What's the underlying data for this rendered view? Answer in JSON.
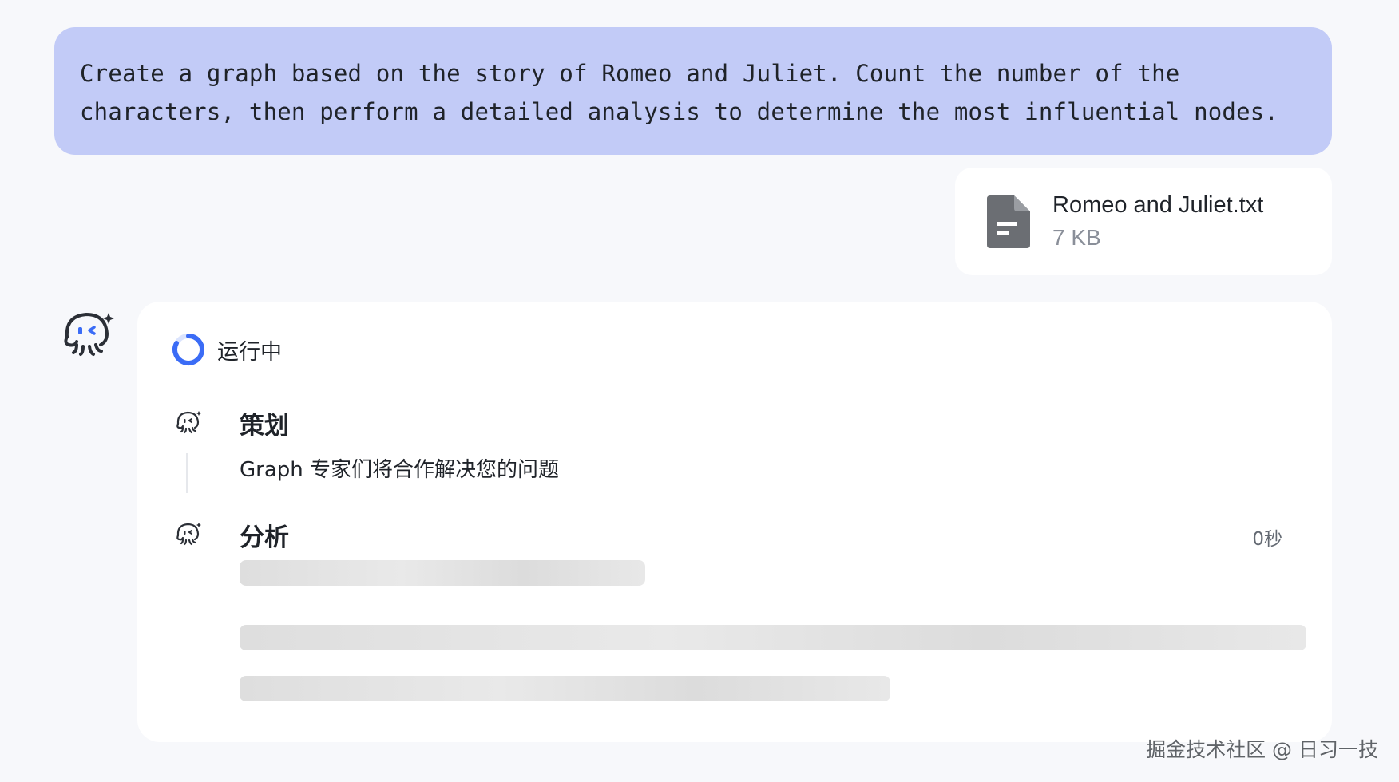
{
  "user_message": {
    "text": "Create a graph based on the story of Romeo and Juliet. Count the number of the characters, then perform a detailed analysis to determine the most influential nodes."
  },
  "attachment": {
    "file_name": "Romeo and Juliet.txt",
    "file_size": "7 KB",
    "icon": "document-icon"
  },
  "assistant": {
    "avatar_icon": "octopus-bot-icon",
    "status": "运行中",
    "steps": [
      {
        "title": "策划",
        "description": "Graph 专家们将合作解决您的问题",
        "icon": "octopus-bot-icon"
      },
      {
        "title": "分析",
        "timer": "0秒",
        "icon": "octopus-bot-icon",
        "loading": true
      }
    ]
  },
  "watermark": "掘金技术社区 @ 日习一技",
  "colors": {
    "user_bubble": "#c2cbf7",
    "spinner_accent": "#3b6cf6",
    "background": "#f7f8fb"
  }
}
